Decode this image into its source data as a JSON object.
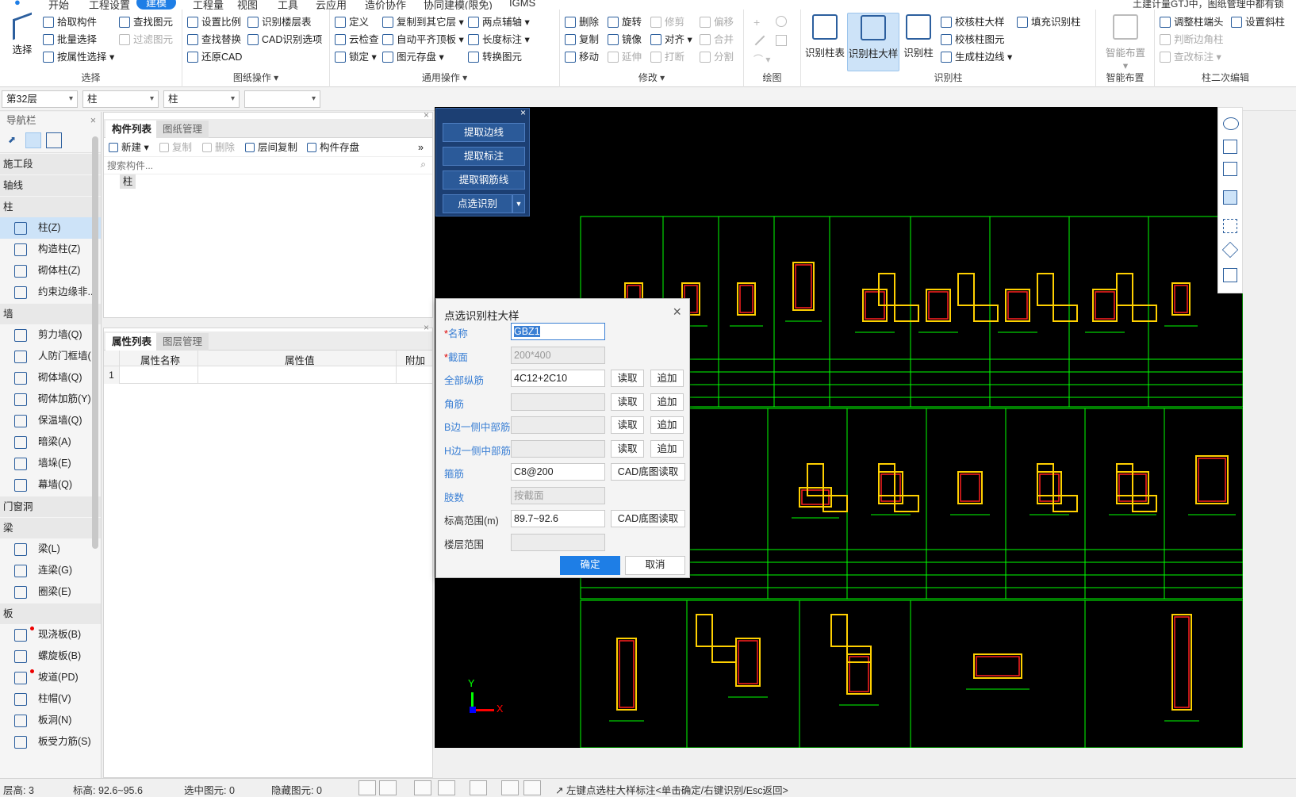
{
  "menu": {
    "items": [
      "开始",
      "工程设置",
      "建模",
      "工程量",
      "视图",
      "工具",
      "云应用",
      "造价协作",
      "协同建模(限免)",
      "IGMS"
    ],
    "active_index": 2,
    "notice": "土建计量GTJ中，图纸管理中都有锁"
  },
  "ribbon": {
    "select": {
      "label": "选择",
      "big": "选择",
      "items": [
        "拾取构件",
        "批量选择",
        "按属性选择",
        "查找图元",
        "过滤图元"
      ]
    },
    "drawing_ops": {
      "label": "图纸操作",
      "items": [
        "设置比例",
        "查找替换",
        "还原CAD",
        "识别楼层表",
        "CAD识别选项"
      ]
    },
    "common_ops": {
      "label": "通用操作",
      "items": [
        "定义",
        "云检查",
        "锁定",
        "复制到其它层",
        "自动平齐顶板",
        "图元存盘",
        "两点辅轴",
        "长度标注",
        "转换图元"
      ]
    },
    "modify": {
      "label": "修改",
      "items": [
        "删除",
        "复制",
        "移动",
        "旋转",
        "镜像",
        "延伸",
        "修剪",
        "对齐",
        "打断",
        "偏移",
        "合并",
        "分割"
      ]
    },
    "draw": {
      "label": "绘图"
    },
    "recognize": {
      "label": "识别柱",
      "big": [
        "识别柱表",
        "识别柱大样",
        "识别柱"
      ],
      "items": [
        "校核柱大样",
        "校核柱图元",
        "生成柱边线",
        "填充识别柱"
      ]
    },
    "smart": {
      "label": "智能布置",
      "big": "智能布置"
    },
    "col_edit": {
      "label": "柱二次编辑",
      "items": [
        "调整柱端头",
        "设置斜柱",
        "判断边角柱",
        "查改标注"
      ]
    }
  },
  "toolbar2": {
    "floor": "第32层",
    "type": "柱",
    "subtype": "柱",
    "extra": ""
  },
  "nav": {
    "title": "导航栏",
    "groups": [
      {
        "name": "施工段",
        "items": []
      },
      {
        "name": "轴线",
        "items": []
      },
      {
        "name": "柱",
        "items": [
          "柱(Z)",
          "构造柱(Z)",
          "砌体柱(Z)",
          "约束边缘非..."
        ]
      },
      {
        "name": "墙",
        "items": [
          "剪力墙(Q)",
          "人防门框墙(",
          "砌体墙(Q)",
          "砌体加筋(Y)",
          "保温墙(Q)",
          "暗梁(A)",
          "墙垛(E)",
          "幕墙(Q)"
        ]
      },
      {
        "name": "门窗洞",
        "items": []
      },
      {
        "name": "梁",
        "items": [
          "梁(L)",
          "连梁(G)",
          "圈梁(E)"
        ]
      },
      {
        "name": "板",
        "items": [
          "现浇板(B)",
          "螺旋板(B)",
          "坡道(PD)",
          "柱帽(V)",
          "板洞(N)",
          "板受力筋(S)"
        ]
      }
    ]
  },
  "comp_panel": {
    "tabs": [
      "构件列表",
      "图纸管理"
    ],
    "tools": [
      "新建",
      "复制",
      "删除",
      "层间复制",
      "构件存盘"
    ],
    "search_placeholder": "搜索构件...",
    "tree_item": "柱"
  },
  "attr_panel": {
    "tabs": [
      "属性列表",
      "图层管理"
    ],
    "headers": [
      "属性名称",
      "属性值",
      "附加"
    ],
    "row_no": "1"
  },
  "float_panel": {
    "buttons": [
      "提取边线",
      "提取标注",
      "提取钢筋线",
      "点选识别"
    ]
  },
  "dialog": {
    "title": "点选识别柱大样",
    "fields": [
      {
        "label": "名称",
        "required": true,
        "value": "GBZ1"
      },
      {
        "label": "截面",
        "required": true,
        "value": "200*400"
      },
      {
        "label": "全部纵筋",
        "value": "4C12+2C10"
      },
      {
        "label": "角筋",
        "value": ""
      },
      {
        "label": "B边一侧中部筋",
        "value": ""
      },
      {
        "label": "H边一侧中部筋",
        "value": ""
      },
      {
        "label": "箍筋",
        "value": "C8@200"
      },
      {
        "label": "肢数",
        "value": "按截面"
      },
      {
        "label": "标高范围(m)",
        "value": "89.7~92.6"
      },
      {
        "label": "楼层范围",
        "value": ""
      }
    ],
    "btn_read": "读取",
    "btn_add": "追加",
    "btn_cad": "CAD底图读取",
    "ok": "确定",
    "cancel": "取消"
  },
  "cad": {
    "axis_x": "X",
    "axis_y": "Y"
  },
  "status": {
    "floor": "层高:  3",
    "elev": "标高:  92.6~95.6",
    "selected": "选中图元:  0",
    "hidden": "隐藏图元:  0",
    "hint": "左键点选柱大样标注<单击确定/右键识别/Esc返回>"
  }
}
